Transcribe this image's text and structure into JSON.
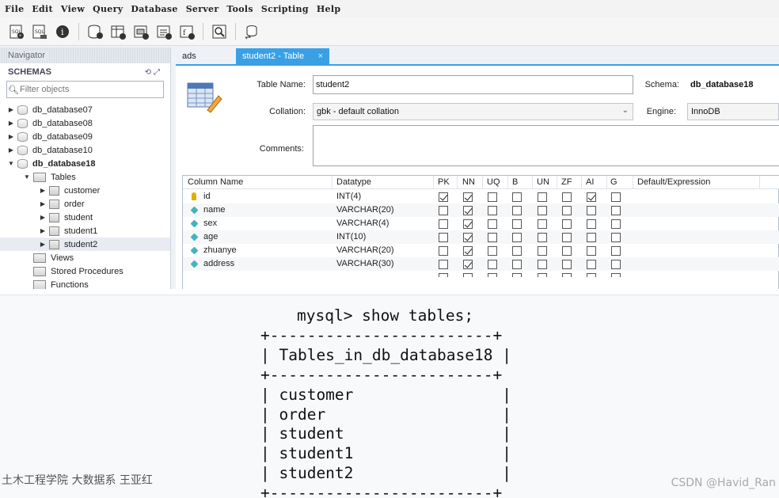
{
  "menu": [
    "File",
    "Edit",
    "View",
    "Query",
    "Database",
    "Server",
    "Tools",
    "Scripting",
    "Help"
  ],
  "toolbar_icons": [
    "new-sql-tab-icon",
    "open-sql-script-icon",
    "inspector-icon",
    "create-schema-icon",
    "create-table-icon",
    "create-view-icon",
    "create-procedure-icon",
    "create-function-icon",
    "search-table-data-icon",
    "reconnect-icon"
  ],
  "navigator": {
    "header": "Navigator",
    "schemas_title": "SCHEMAS",
    "filter_placeholder": "Filter objects",
    "tree": [
      {
        "label": "db_database07",
        "kind": "db",
        "level": 0,
        "twisty": "▶"
      },
      {
        "label": "db_database08",
        "kind": "db",
        "level": 0,
        "twisty": "▶"
      },
      {
        "label": "db_database09",
        "kind": "db",
        "level": 0,
        "twisty": "▶"
      },
      {
        "label": "db_database10",
        "kind": "db",
        "level": 0,
        "twisty": "▶"
      },
      {
        "label": "db_database18",
        "kind": "db",
        "level": 0,
        "twisty": "▼",
        "bold": true
      },
      {
        "label": "Tables",
        "kind": "folder",
        "level": 1,
        "twisty": "▼"
      },
      {
        "label": "customer",
        "kind": "table",
        "level": 2,
        "twisty": "▶"
      },
      {
        "label": "order",
        "kind": "table",
        "level": 2,
        "twisty": "▶"
      },
      {
        "label": "student",
        "kind": "table",
        "level": 2,
        "twisty": "▶"
      },
      {
        "label": "student1",
        "kind": "table",
        "level": 2,
        "twisty": "▶"
      },
      {
        "label": "student2",
        "kind": "table",
        "level": 2,
        "twisty": "▶",
        "selected": true
      },
      {
        "label": "Views",
        "kind": "folder",
        "level": 1,
        "twisty": ""
      },
      {
        "label": "Stored Procedures",
        "kind": "folder",
        "level": 1,
        "twisty": ""
      },
      {
        "label": "Functions",
        "kind": "folder",
        "level": 1,
        "twisty": ""
      }
    ]
  },
  "tabs": [
    {
      "label": "ads",
      "active": false
    },
    {
      "label": "student2 - Table",
      "active": true,
      "close": "×"
    }
  ],
  "editor": {
    "table_name_label": "Table Name:",
    "table_name": "student2",
    "schema_label": "Schema:",
    "schema": "db_database18",
    "collation_label": "Collation:",
    "collation": "gbk - default collation",
    "engine_label": "Engine:",
    "engine": "InnoDB",
    "comments_label": "Comments:",
    "columns_header": [
      "Column Name",
      "Datatype",
      "PK",
      "NN",
      "UQ",
      "B",
      "UN",
      "ZF",
      "AI",
      "G",
      "Default/Expression"
    ],
    "columns": [
      {
        "name": "id",
        "type": "INT(4)",
        "icon": "key",
        "flags": [
          1,
          1,
          0,
          0,
          0,
          0,
          1,
          0
        ]
      },
      {
        "name": "name",
        "type": "VARCHAR(20)",
        "icon": "diamond",
        "flags": [
          0,
          1,
          0,
          0,
          0,
          0,
          0,
          0
        ]
      },
      {
        "name": "sex",
        "type": "VARCHAR(4)",
        "icon": "diamond",
        "flags": [
          0,
          1,
          0,
          0,
          0,
          0,
          0,
          0
        ]
      },
      {
        "name": "age",
        "type": "INT(10)",
        "icon": "diamond",
        "flags": [
          0,
          1,
          0,
          0,
          0,
          0,
          0,
          0
        ]
      },
      {
        "name": "zhuanye",
        "type": "VARCHAR(20)",
        "icon": "diamond",
        "flags": [
          0,
          1,
          0,
          0,
          0,
          0,
          0,
          0
        ]
      },
      {
        "name": "address",
        "type": "VARCHAR(30)",
        "icon": "diamond",
        "flags": [
          0,
          1,
          0,
          0,
          0,
          0,
          0,
          0
        ]
      }
    ]
  },
  "console": {
    "lines": [
      "mysql> show tables;",
      "+------------------------+",
      "| Tables_in_db_database18 |",
      "+------------------------+",
      "| customer                |",
      "| order                   |",
      "| student                 |",
      "| student1                |",
      "| student2                |",
      "+------------------------+"
    ]
  },
  "footer": {
    "left": "土木工程学院 大数据系 王亚红",
    "right": "CSDN @Havid_Ran"
  },
  "colors": {
    "tab_active": "#3aa0e6",
    "key_icon": "#e0b000",
    "column_icon": "#45b3bf"
  }
}
